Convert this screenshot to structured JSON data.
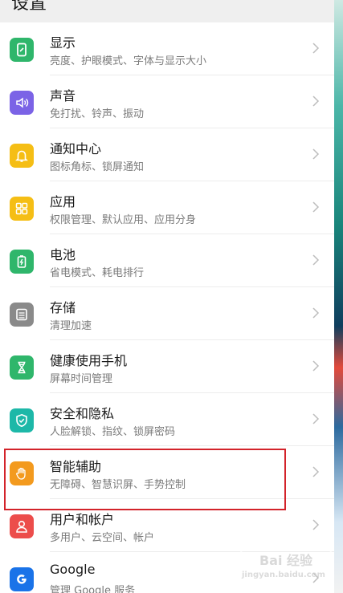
{
  "header": {
    "title": "设置"
  },
  "items": [
    {
      "key": "display",
      "title": "显示",
      "subtitle": "亮度、护眼模式、字体与显示大小",
      "icon": "display-icon",
      "color": "#2fb66b"
    },
    {
      "key": "sound",
      "title": "声音",
      "subtitle": "免打扰、铃声、振动",
      "icon": "sound-icon",
      "color": "#7b63e6"
    },
    {
      "key": "notifications",
      "title": "通知中心",
      "subtitle": "图标角标、锁屏通知",
      "icon": "bell-icon",
      "color": "#f5be15"
    },
    {
      "key": "apps",
      "title": "应用",
      "subtitle": "权限管理、默认应用、应用分身",
      "icon": "apps-grid-icon",
      "color": "#f5be15"
    },
    {
      "key": "battery",
      "title": "电池",
      "subtitle": "省电模式、耗电排行",
      "icon": "battery-icon",
      "color": "#2fb66b"
    },
    {
      "key": "storage",
      "title": "存储",
      "subtitle": "清理加速",
      "icon": "storage-icon",
      "color": "#8a8a8a"
    },
    {
      "key": "digital-balance",
      "title": "健康使用手机",
      "subtitle": "屏幕时间管理",
      "icon": "hourglass-icon",
      "color": "#2fb66b"
    },
    {
      "key": "security",
      "title": "安全和隐私",
      "subtitle": "人脸解锁、指纹、锁屏密码",
      "icon": "shield-icon",
      "color": "#1db8a8"
    },
    {
      "key": "accessibility",
      "title": "智能辅助",
      "subtitle": "无障碍、智慧识屏、手势控制",
      "icon": "hand-icon",
      "color": "#f39a1e"
    },
    {
      "key": "users",
      "title": "用户和帐户",
      "subtitle": "多用户、云空间、帐户",
      "icon": "user-icon",
      "color": "#ec4d4b"
    },
    {
      "key": "google",
      "title": "Google",
      "subtitle": "管理 Google 服务",
      "icon": "google-icon",
      "color": "#1a73e8"
    }
  ],
  "watermark": {
    "logo": "Bai 经验",
    "url": "jingyan.baidu.com"
  }
}
